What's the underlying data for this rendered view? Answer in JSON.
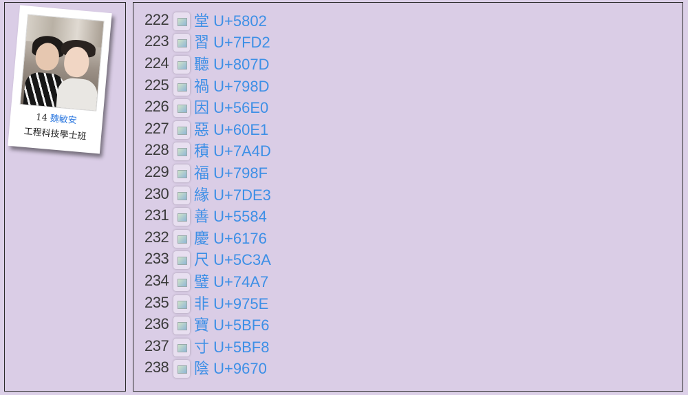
{
  "profile": {
    "number": "14",
    "name": "魏敏安",
    "program": "工程科技學士班"
  },
  "entries": [
    {
      "index": "222",
      "char": "堂",
      "code": "U+5802"
    },
    {
      "index": "223",
      "char": "習",
      "code": "U+7FD2"
    },
    {
      "index": "224",
      "char": "聽",
      "code": "U+807D"
    },
    {
      "index": "225",
      "char": "禍",
      "code": "U+798D"
    },
    {
      "index": "226",
      "char": "因",
      "code": "U+56E0"
    },
    {
      "index": "227",
      "char": "惡",
      "code": "U+60E1"
    },
    {
      "index": "228",
      "char": "積",
      "code": "U+7A4D"
    },
    {
      "index": "229",
      "char": "福",
      "code": "U+798F"
    },
    {
      "index": "230",
      "char": "緣",
      "code": "U+7DE3"
    },
    {
      "index": "231",
      "char": "善",
      "code": "U+5584"
    },
    {
      "index": "232",
      "char": "慶",
      "code": "U+6176"
    },
    {
      "index": "233",
      "char": "尺",
      "code": "U+5C3A"
    },
    {
      "index": "234",
      "char": "璧",
      "code": "U+74A7"
    },
    {
      "index": "235",
      "char": "非",
      "code": "U+975E"
    },
    {
      "index": "236",
      "char": "寶",
      "code": "U+5BF6"
    },
    {
      "index": "237",
      "char": "寸",
      "code": "U+5BF8"
    },
    {
      "index": "238",
      "char": "陰",
      "code": "U+9670"
    }
  ],
  "colors": {
    "background": "#dacde6",
    "link": "#3d8fe6",
    "index_text": "#3a3a3a"
  },
  "icons": {
    "row_image": "broken-image-icon"
  }
}
